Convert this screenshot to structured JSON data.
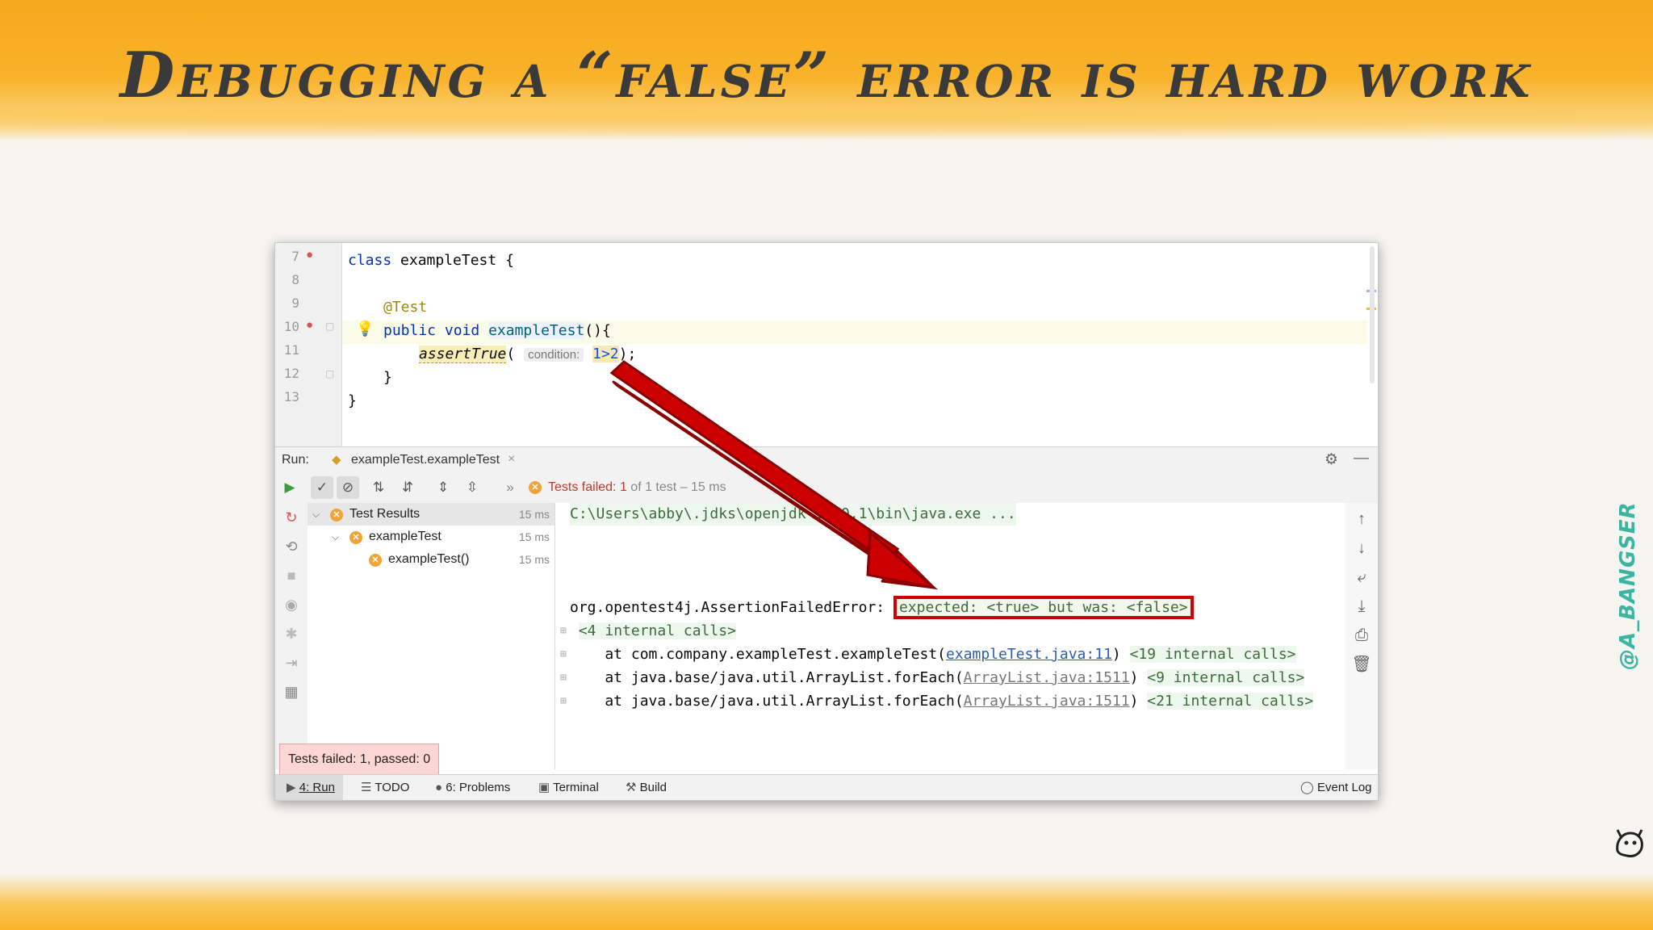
{
  "slide": {
    "title": "Debugging a “false” error is hard work",
    "watermark": "@A_BANGSER"
  },
  "editor": {
    "line_numbers": [
      "7",
      "8",
      "9",
      "10",
      "11",
      "12",
      "13"
    ],
    "line7_kw": "class",
    "line7_rest": " exampleTest {",
    "line9_annotation": "@Test",
    "line10_kw": "public void",
    "line10_fn": "exampleTest",
    "line10_rest": "(){",
    "line11_method": "assertTrue",
    "line11_open": "( ",
    "line11_hint": "condition:",
    "line11_arg": "1>2",
    "line11_close": ");",
    "line12": "}",
    "line13": "}"
  },
  "run_panel": {
    "label": "Run:",
    "tab_title": "exampleTest.exampleTest",
    "tab_close": "×",
    "status_prefix": "Tests failed: ",
    "status_count": "1",
    "status_suffix": " of 1 test – 15 ms",
    "more_glyph": "»"
  },
  "tree": {
    "items": [
      {
        "label": "Test Results",
        "time": "15 ms"
      },
      {
        "label": "exampleTest",
        "time": "15 ms"
      },
      {
        "label": "exampleTest()",
        "time": "15 ms"
      }
    ]
  },
  "console": {
    "cmd": "C:\\Users\\abby\\.jdks\\openjdk-15.0.1\\bin\\java.exe ...",
    "error_class": "org.opentest4j.AssertionFailedError: ",
    "error_message": "expected: <true> but was: <false>",
    "internal_calls_1": "<4 internal calls>",
    "trace": [
      {
        "prefix": "    at com.company.exampleTest.exampleTest(",
        "link": "exampleTest.java:11",
        "suffix": ") ",
        "calls": "<19 internal calls>"
      },
      {
        "prefix": "    at java.base/java.util.ArrayList.forEach(",
        "link": "ArrayList.java:1511",
        "suffix": ") ",
        "calls": "<9 internal calls>"
      },
      {
        "prefix": "    at java.base/java.util.ArrayList.forEach(",
        "link": "ArrayList.java:1511",
        "suffix": ") ",
        "calls": "<21 internal calls>"
      }
    ]
  },
  "popup": "Tests failed: 1, passed: 0",
  "status_bar": {
    "run": "4: Run",
    "todo": "TODO",
    "problems": "6: Problems",
    "terminal": "Terminal",
    "build": "Build",
    "event_log": "Event Log"
  },
  "colors": {
    "accent_band": "#f7a81d",
    "arrow": "#cc0000",
    "error_box": "#cc0000"
  }
}
